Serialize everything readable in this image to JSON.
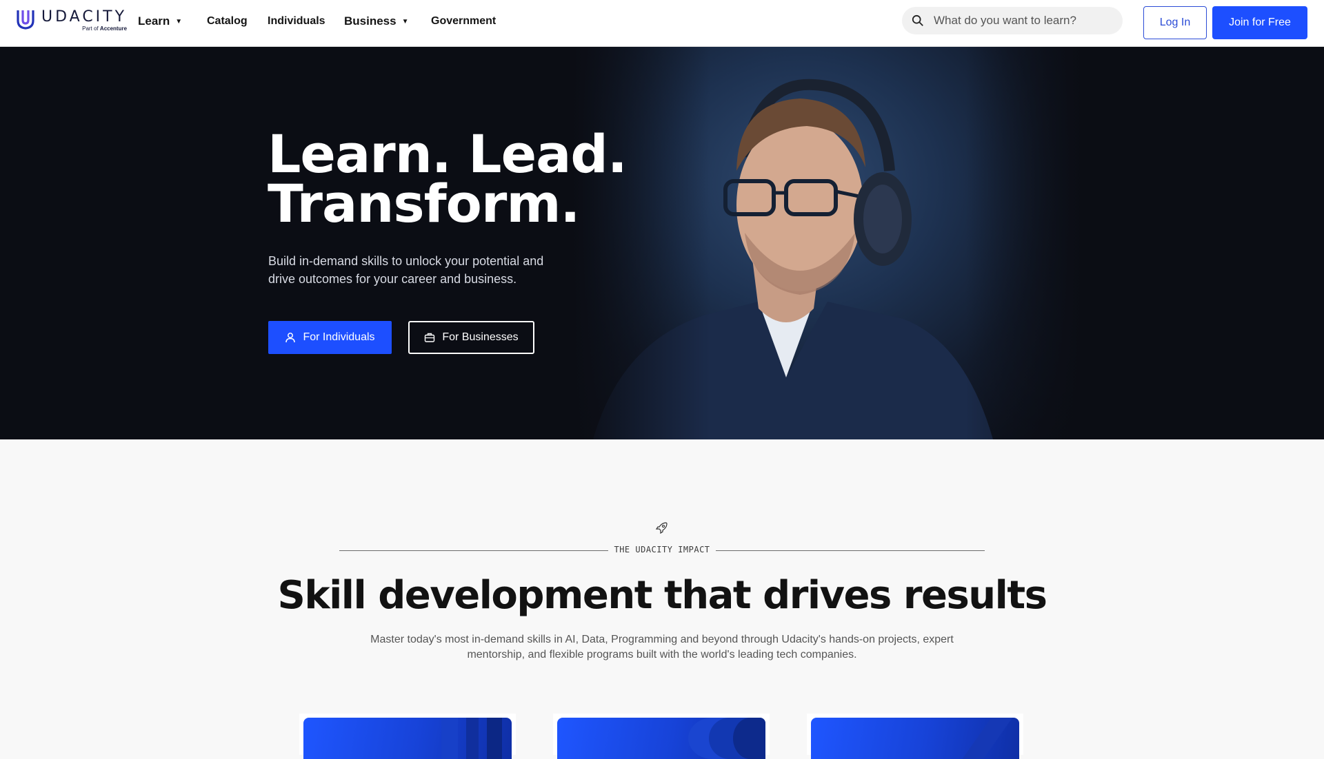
{
  "nav": {
    "logo_word": "UDACITY",
    "logo_sub_prefix": "Part of",
    "logo_sub_brand": "Accenture",
    "learn": "Learn",
    "catalog": "Catalog",
    "individuals": "Individuals",
    "business": "Business",
    "government": "Government",
    "search_placeholder": "What do you want to learn?",
    "login": "Log In",
    "join": "Join for Free"
  },
  "hero": {
    "title_line1": "Learn. Lead.",
    "title_line2": "Transform.",
    "subtitle": "Build in-demand skills to unlock your potential and drive outcomes for your career and business.",
    "btn_individuals": "For Individuals",
    "btn_businesses": "For Businesses"
  },
  "impact": {
    "eyebrow": "THE UDACITY IMPACT",
    "title": "Skill development that drives results",
    "subtitle": "Master today's most in-demand skills in AI, Data, Programming and beyond through Udacity's hands-on projects, expert mentorship, and flexible programs built with the world's leading tech companies."
  },
  "colors": {
    "accent": "#1d4fff",
    "hero_bg": "#0b0d14",
    "page_bg": "#f8f8f8"
  },
  "icons": [
    "udacity-logo",
    "chevron-down-icon",
    "search-icon",
    "person-icon",
    "briefcase-icon",
    "rocket-icon"
  ]
}
